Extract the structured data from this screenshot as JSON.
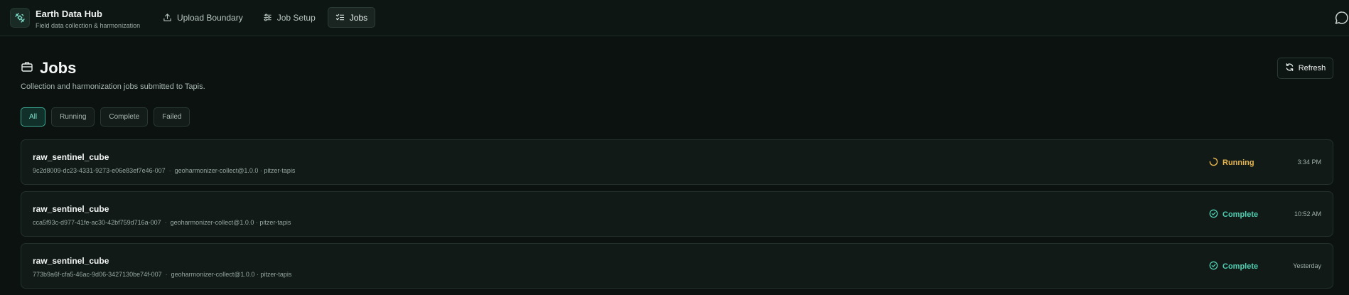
{
  "app": {
    "title": "Earth Data Hub",
    "subtitle": "Field data collection & harmonization"
  },
  "nav": {
    "upload": "Upload Boundary",
    "setup": "Job Setup",
    "jobs": "Jobs"
  },
  "page": {
    "title": "Jobs",
    "subtitle": "Collection and harmonization jobs submitted to Tapis.",
    "refresh_label": "Refresh"
  },
  "filters": {
    "all": "All",
    "running": "Running",
    "complete": "Complete",
    "failed": "Failed",
    "selected": "All"
  },
  "jobs": [
    {
      "name": "raw_sentinel_cube",
      "id": "9c2d8009-dc23-4331-9273-e06e83ef7e46-007",
      "app": "geoharmonizer-collect@1.0.0 · pitzer-tapis",
      "status": "Running",
      "time": "3:34 PM"
    },
    {
      "name": "raw_sentinel_cube",
      "id": "cca5f93c-d977-41fe-ac30-42bf759d716a-007",
      "app": "geoharmonizer-collect@1.0.0 · pitzer-tapis",
      "status": "Complete",
      "time": "10:52 AM"
    },
    {
      "name": "raw_sentinel_cube",
      "id": "773b9a6f-cfa5-46ac-9d06-3427130be74f-007",
      "app": "geoharmonizer-collect@1.0.0 · pitzer-tapis",
      "status": "Complete",
      "time": "Yesterday"
    }
  ],
  "colors": {
    "accent": "#4fcfb2",
    "running": "#e8b64c",
    "background": "#0b1210"
  },
  "icons": {
    "logo": "satellite-icon",
    "upload": "upload-icon",
    "setup": "sliders-icon",
    "jobs": "list-check-icon",
    "chat": "chat-bubble-icon",
    "page": "briefcase-icon",
    "refresh": "refresh-icon",
    "running": "spinner-icon",
    "complete": "check-circle-icon"
  }
}
